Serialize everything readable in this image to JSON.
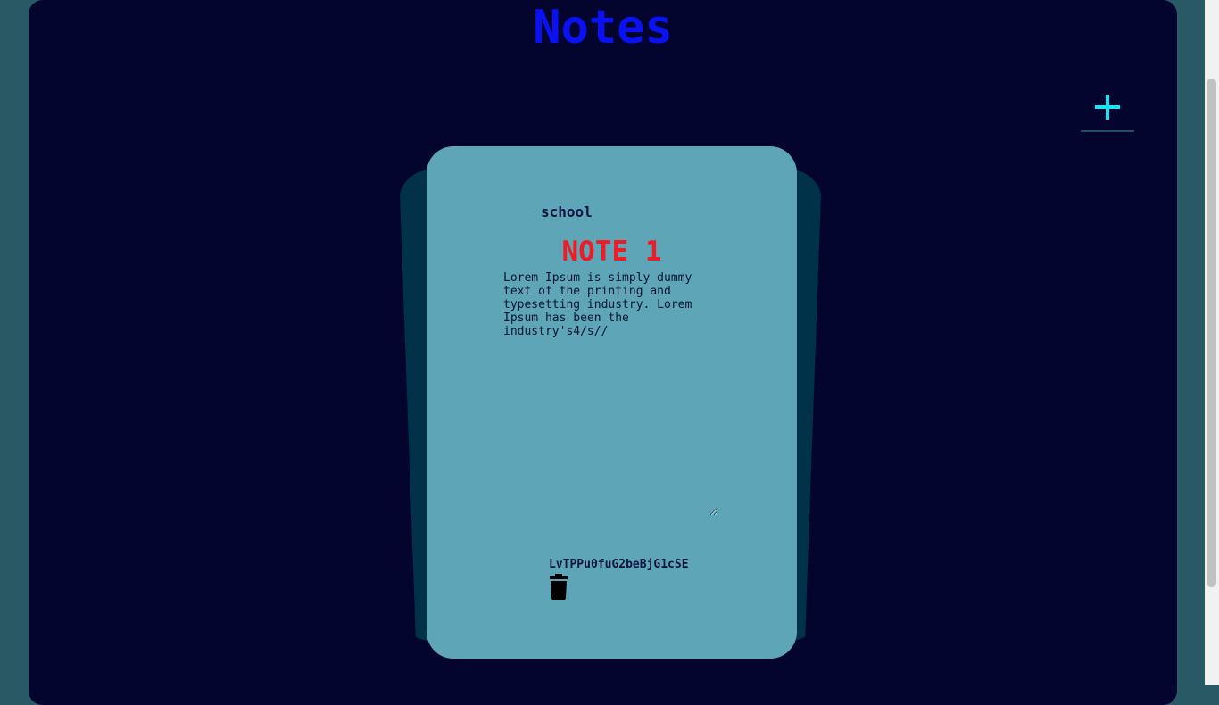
{
  "header": {
    "title": "Notes"
  },
  "toolbar": {
    "add_icon": "plus-icon",
    "add_color": "#17e6f2"
  },
  "note": {
    "category": "school",
    "title": "NOTE 1",
    "body": "Lorem Ipsum is simply dummy text of the printing and typesetting industry. Lorem Ipsum has been the industry's4/s//",
    "id": "LvTPPu0fuG2beBjG1cSE",
    "delete_icon": "trash-icon"
  },
  "colors": {
    "background": "#2a5966",
    "frame": "#03052e",
    "title": "#0a12f5",
    "card": "#5ea5b8",
    "card_back": "#003249",
    "note_title": "#ee1c25"
  }
}
